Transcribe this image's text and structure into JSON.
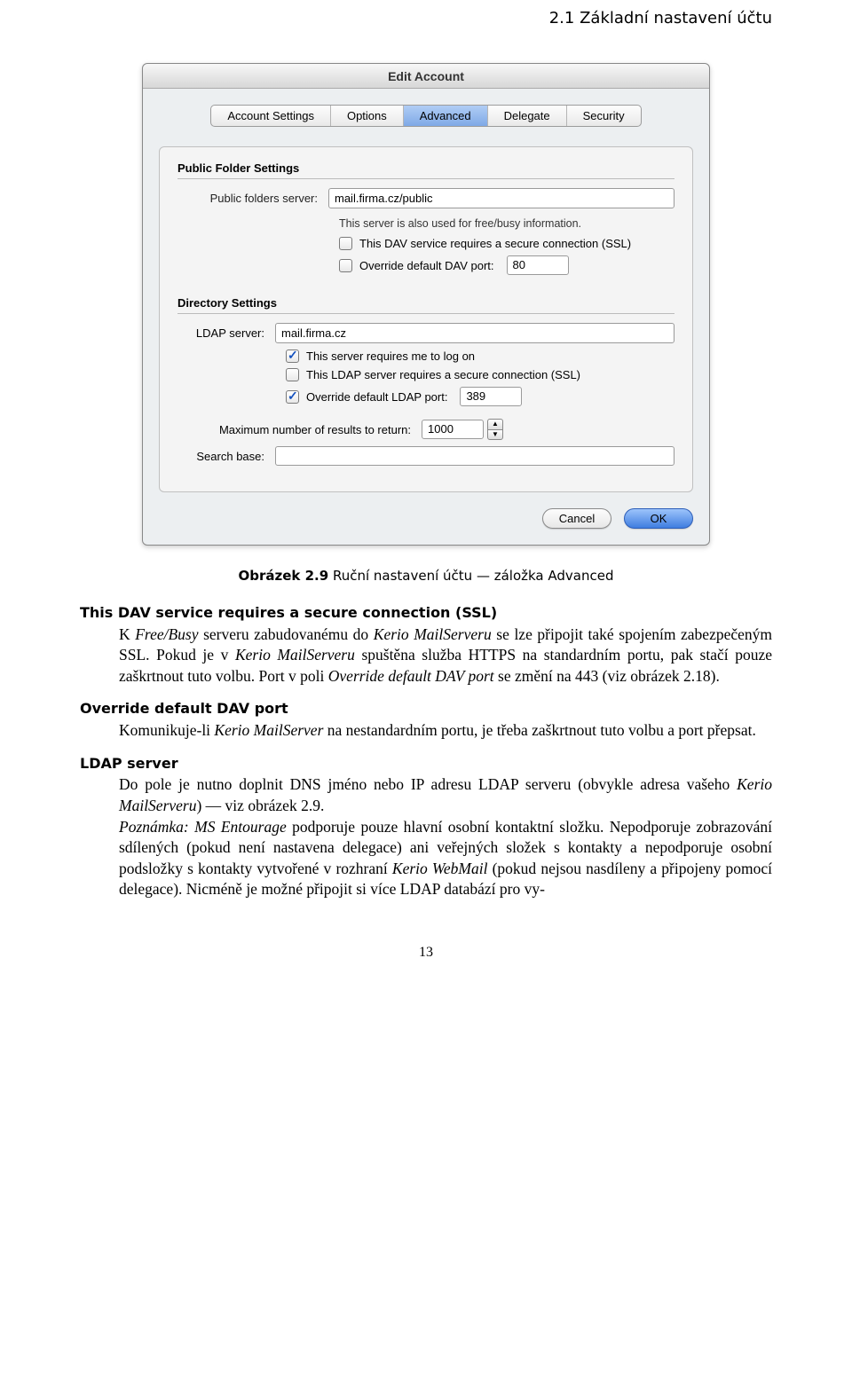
{
  "header": {
    "right": "2.1  Základní nastavení účtu"
  },
  "window": {
    "title": "Edit Account",
    "tabs": [
      "Account Settings",
      "Options",
      "Advanced",
      "Delegate",
      "Security"
    ],
    "active_tab": 2,
    "public": {
      "section": "Public Folder Settings",
      "server_label": "Public folders server:",
      "server_value": "mail.firma.cz/public",
      "hint": "This server is also used for free/busy information.",
      "ssl_label": "This DAV service requires a secure connection (SSL)",
      "override_label": "Override default DAV port:",
      "override_port": "80"
    },
    "dir": {
      "section": "Directory Settings",
      "ldap_label": "LDAP server:",
      "ldap_value": "mail.firma.cz",
      "logon_label": "This server requires me to log on",
      "ssl_label": "This LDAP server requires a secure connection (SSL)",
      "override_label": "Override default LDAP port:",
      "override_port": "389",
      "max_label": "Maximum number of results to return:",
      "max_value": "1000",
      "search_label": "Search base:",
      "search_value": ""
    },
    "buttons": {
      "cancel": "Cancel",
      "ok": "OK"
    }
  },
  "caption": {
    "prefix": "Obrázek 2.9",
    "rest": "  Ruční nastavení účtu — záložka Advanced"
  },
  "doc": {
    "t1": "This DAV service requires a secure connection (SSL)",
    "p1a": "K ",
    "p1b": "Free/Busy",
    "p1c": " serveru zabudovanému do ",
    "p1d": "Kerio MailServeru",
    "p1e": " se lze připojit také spojením zabezpečeným SSL. Pokud je v ",
    "p1f": "Kerio MailServeru",
    "p1g": " spuštěna služba HTTPS na standardním portu, pak stačí pouze zaškrtnout tuto volbu. Port v poli ",
    "p1h": "Override default DAV port",
    "p1i": " se změní na 443 (viz obrázek 2.18).",
    "t2": "Override default DAV port",
    "p2a": "Komunikuje-li ",
    "p2b": "Kerio MailServer",
    "p2c": " na nestandardním portu, je třeba zaškrtnout tuto volbu a port přepsat.",
    "t3": "LDAP server",
    "p3a": "Do pole je nutno doplnit DNS jméno nebo IP adresu LDAP serveru (obvykle adresa vašeho ",
    "p3b": "Kerio MailServeru",
    "p3c": ") — viz obrázek 2.9.",
    "p3d": "Poznámka: MS Entourage",
    "p3e": " podporuje pouze hlavní osobní kontaktní složku. Nepodporuje zobrazování sdílených (pokud není nastavena delegace) ani veřejných složek s kontakty a nepodporuje osobní podsložky s kontakty vytvořené v rozhraní ",
    "p3f": "Kerio WebMail",
    "p3g": " (pokud nejsou nasdíleny a připojeny pomocí delegace). Nicméně je možné připojit si více LDAP databází pro vy-"
  },
  "pagenum": "13"
}
